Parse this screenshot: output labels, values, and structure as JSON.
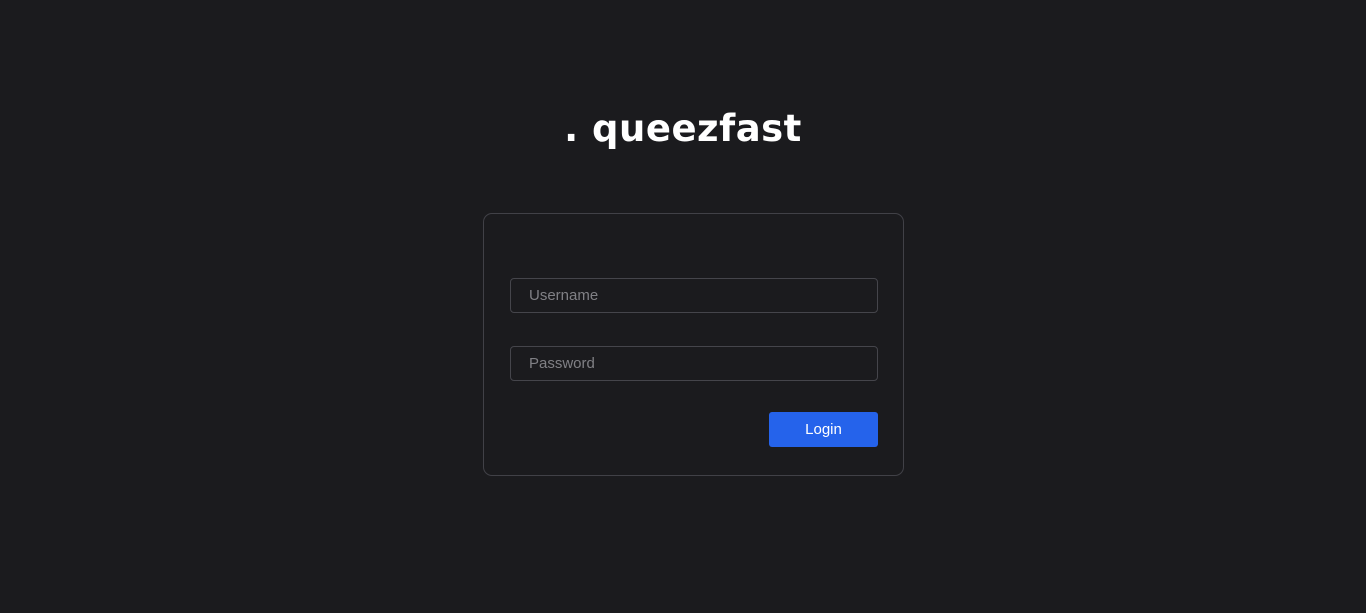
{
  "app": {
    "logo_text": ". queezfast"
  },
  "login_form": {
    "username": {
      "placeholder": "Username",
      "value": ""
    },
    "password": {
      "placeholder": "Password",
      "value": ""
    },
    "submit_label": "Login"
  },
  "colors": {
    "background": "#1b1b1e",
    "card_border": "#414147",
    "input_border": "#45454b",
    "accent": "#2563eb",
    "text": "#ffffff",
    "placeholder": "#808085"
  }
}
